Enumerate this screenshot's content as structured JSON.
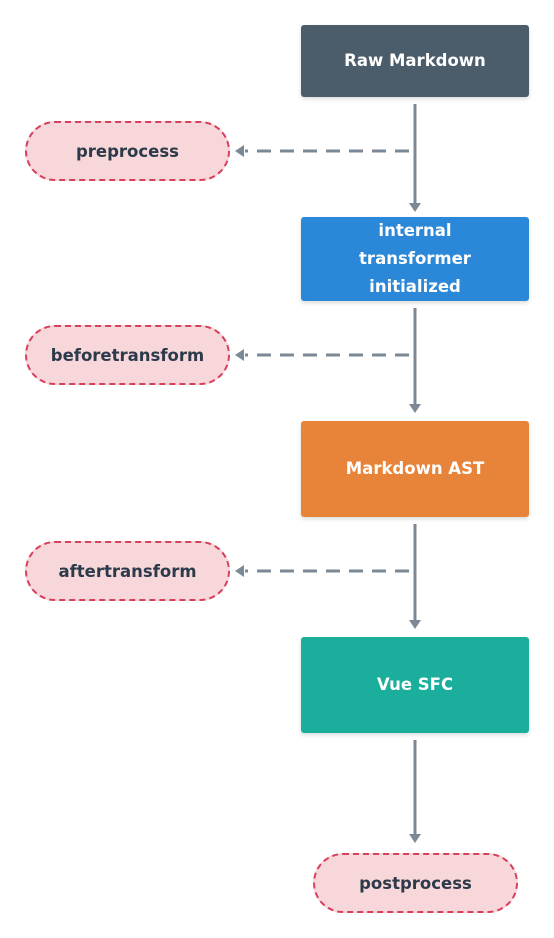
{
  "diagram": {
    "type": "flowchart",
    "direction": "top-to-bottom",
    "colors": {
      "raw_markdown": "#4b5d6b",
      "internal_transformer": "#2b88d8",
      "markdown_ast": "#e8843a",
      "vue_sfc": "#1bae9c",
      "hook_fill": "#f8d7da",
      "hook_border": "#d6405a",
      "connector": "#7b8895",
      "hook_text": "#2c3a4a"
    },
    "nodes": [
      {
        "id": "raw-markdown",
        "label": "Raw Markdown"
      },
      {
        "id": "internal-transformer",
        "label": "internal transformer initialized"
      },
      {
        "id": "markdown-ast",
        "label": "Markdown AST"
      },
      {
        "id": "vue-sfc",
        "label": "Vue SFC"
      }
    ],
    "hooks": [
      {
        "id": "preprocess",
        "label": "preprocess"
      },
      {
        "id": "beforetransform",
        "label": "beforetransform"
      },
      {
        "id": "aftertransform",
        "label": "aftertransform"
      },
      {
        "id": "postprocess",
        "label": "postprocess"
      }
    ],
    "edges": [
      {
        "from": "raw-markdown",
        "to": "internal-transformer",
        "style": "solid"
      },
      {
        "from": "internal-transformer",
        "to": "markdown-ast",
        "style": "solid"
      },
      {
        "from": "markdown-ast",
        "to": "vue-sfc",
        "style": "solid"
      },
      {
        "from": "vue-sfc",
        "to": "postprocess",
        "style": "solid"
      },
      {
        "from": "raw-markdown/internal-transformer edge",
        "to": "preprocess",
        "style": "dashed"
      },
      {
        "from": "internal-transformer/markdown-ast edge",
        "to": "beforetransform",
        "style": "dashed"
      },
      {
        "from": "markdown-ast/vue-sfc edge",
        "to": "aftertransform",
        "style": "dashed"
      }
    ]
  }
}
